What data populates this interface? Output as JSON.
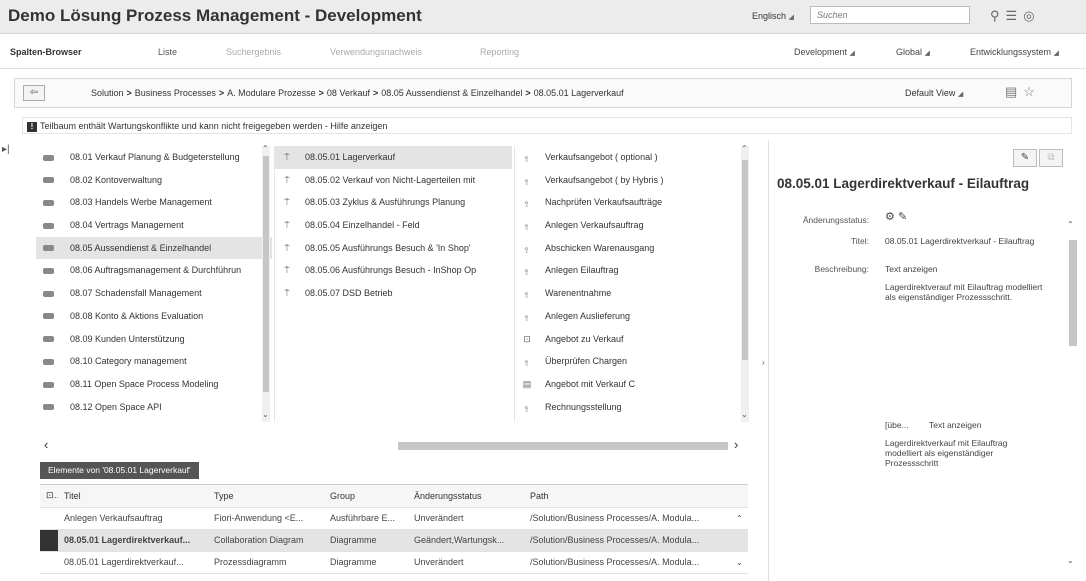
{
  "app": {
    "title": "Demo Lösung Prozess Management - Development",
    "language": "Englisch",
    "search_placeholder": "Suchen"
  },
  "tabs": [
    {
      "label": "Spalten-Browser",
      "active": true
    },
    {
      "label": "Liste"
    },
    {
      "label": "Suchergebnis"
    },
    {
      "label": "Verwendungsnachweis"
    },
    {
      "label": "Reporting"
    }
  ],
  "context": {
    "branch": "Development",
    "scope": "Global",
    "system": "Entwicklungssystem"
  },
  "breadcrumb": {
    "items": [
      "Solution",
      "Business Processes",
      "A. Modulare Prozesse",
      "08 Verkauf",
      "08.05 Aussendienst & Einzelhandel",
      "08.05.01 Lagerverkauf"
    ],
    "separator": ">",
    "default_view": "Default View"
  },
  "warning": {
    "text": "Teilbaum enthält Wartungskonflikte und kann nicht freigegeben werden - Hilfe anzeigen"
  },
  "columns": {
    "col1": [
      "08.01 Verkauf Planung & Budgeterstellung",
      "08.02 Kontoverwaltung",
      "08.03 Handels Werbe Management",
      "08.04 Vertrags Management",
      "08.05 Aussendienst & Einzelhandel",
      "08.06 Auftragsmanagement & Durchführun",
      "08.07 Schadensfall Management",
      "08.08 Konto & Aktions Evaluation",
      "08.09 Kunden Unterstützung",
      "08.10 Category management",
      "08.11 Open Space Process Modeling",
      "08.12 Open Space API"
    ],
    "col1_selected": 4,
    "col2": [
      "08.05.01 Lagerverkauf",
      "08.05.02 Verkauf von Nicht-Lagerteilen mit",
      "08.05.03 Zyklus & Ausführungs Planung",
      "08.05.04 Einzelhandel - Feld",
      "08.05.05 Ausführungs Besuch & 'In Shop'",
      "08.05.06 Ausführungs Besuch - InShop Op",
      "08.05.07 DSD Betrieb"
    ],
    "col2_selected": 0,
    "col3": [
      {
        "label": "Verkaufsangebot ( optional )",
        "icon": "step-icon"
      },
      {
        "label": "Verkaufsangebot ( by Hybris )",
        "icon": "step-icon"
      },
      {
        "label": "Nachprüfen Verkaufsaufträge",
        "icon": "step-icon"
      },
      {
        "label": "Anlegen Verkaufsauftrag",
        "icon": "step-icon"
      },
      {
        "label": "Abschicken Warenausgang",
        "icon": "step-icon"
      },
      {
        "label": "Anlegen Eilauftrag",
        "icon": "step-icon"
      },
      {
        "label": "Warenentnahme",
        "icon": "step-icon"
      },
      {
        "label": "Anlegen Auslieferung",
        "icon": "step-icon"
      },
      {
        "label": "Angebot zu Verkauf",
        "icon": "collaboration-icon"
      },
      {
        "label": "Überprüfen Chargen",
        "icon": "step-icon"
      },
      {
        "label": "Angebot mit Verkauf C",
        "icon": "diagram-icon"
      },
      {
        "label": "Rechnungsstellung",
        "icon": "step-icon"
      }
    ]
  },
  "elements": {
    "tab_label": "Elemente von '08.05.01 Lagerverkauf'",
    "headers": [
      "Titel",
      "Type",
      "Group",
      "Änderungsstatus",
      "Path"
    ],
    "rows": [
      [
        "Anlegen Verkaufsauftrag",
        "Fiori-Anwendung <E...",
        "Ausführbare E...",
        "Unverändert",
        "/Solution/Business Processes/A. Modula..."
      ],
      [
        "08.05.01 Lagerdirektverkauf...",
        "Collaboration Diagram",
        "Diagramme",
        "Geändert,Wartungsk...",
        "/Solution/Business Processes/A. Modula..."
      ],
      [
        "08.05.01 Lagerdirektverkauf...",
        "Prozessdiagramm",
        "Diagramme",
        "Unverändert",
        "/Solution/Business Processes/A. Modula..."
      ]
    ],
    "selected_row": 1
  },
  "detail": {
    "title": "08.05.01 Lagerdirektverkauf - Eilauftrag",
    "status_label": "Änderungsstatus:",
    "title_label": "Titel:",
    "title_value": "08.05.01 Lagerdirektverkauf - Eilauftrag",
    "description_label": "Beschreibung:",
    "show_text": "Text anzeigen",
    "description_value": "Lagerdirektverauf mit Eilauftrag modelliert als eigenständiger Prozessschritt.",
    "second_prefix": "[übe...",
    "second_show_text": "Text anzeigen",
    "second_value": "Lagerdirektverkauf mit Eilauftrag modelliert als eigenständiger Prozessschritt"
  }
}
